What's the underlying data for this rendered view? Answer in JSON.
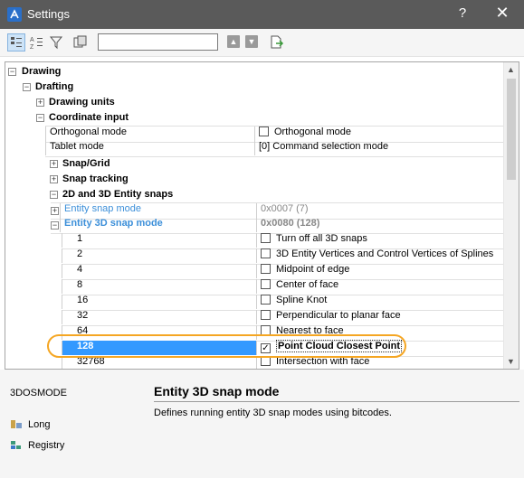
{
  "window": {
    "title": "Settings",
    "help_label": "?",
    "close_label": "✕"
  },
  "toolbar": {
    "search_value": "",
    "icons": [
      "categorized-view-icon",
      "alphabetic-view-icon",
      "filter-icon",
      "export-icon",
      "up-arrow-icon",
      "down-arrow-icon",
      "open-file-icon"
    ]
  },
  "tree": {
    "drawing": "Drawing",
    "drafting": "Drafting",
    "drawing_units": "Drawing units",
    "coordinate_input": "Coordinate input",
    "ortho_key": "Orthogonal mode",
    "ortho_val": "Orthogonal mode",
    "tablet_key": "Tablet mode",
    "tablet_val": "[0] Command selection mode",
    "snap_grid": "Snap/Grid",
    "snap_tracking": "Snap tracking",
    "entity_snaps": "2D and 3D Entity snaps",
    "entity_snap_mode_key": "Entity snap mode",
    "entity_snap_mode_val": "0x0007 (7)",
    "entity_3d_key": "Entity 3D snap mode",
    "entity_3d_val": "0x0080 (128)",
    "bits": [
      {
        "code": "1",
        "label": "Turn off all 3D snaps",
        "checked": false
      },
      {
        "code": "2",
        "label": "3D Entity Vertices and Control Vertices of Splines",
        "checked": false
      },
      {
        "code": "4",
        "label": "Midpoint of edge",
        "checked": false
      },
      {
        "code": "8",
        "label": "Center of face",
        "checked": false
      },
      {
        "code": "16",
        "label": "Spline Knot",
        "checked": false
      },
      {
        "code": "32",
        "label": "Perpendicular to planar face",
        "checked": false
      },
      {
        "code": "64",
        "label": "Nearest to face",
        "checked": false
      },
      {
        "code": "128",
        "label": "Point Cloud Closest Point",
        "checked": true
      },
      {
        "code": "32768",
        "label": "Intersection with face",
        "checked": false
      }
    ]
  },
  "details": {
    "variable": "3DOSMODE",
    "title": "Entity 3D snap mode",
    "description": "Defines running entity 3D snap modes using bitcodes.",
    "type": "Long",
    "scope": "Registry"
  },
  "colors": {
    "accent": "#3c8fd9",
    "selection": "#3399ff",
    "highlight_ring": "#f5a623"
  }
}
